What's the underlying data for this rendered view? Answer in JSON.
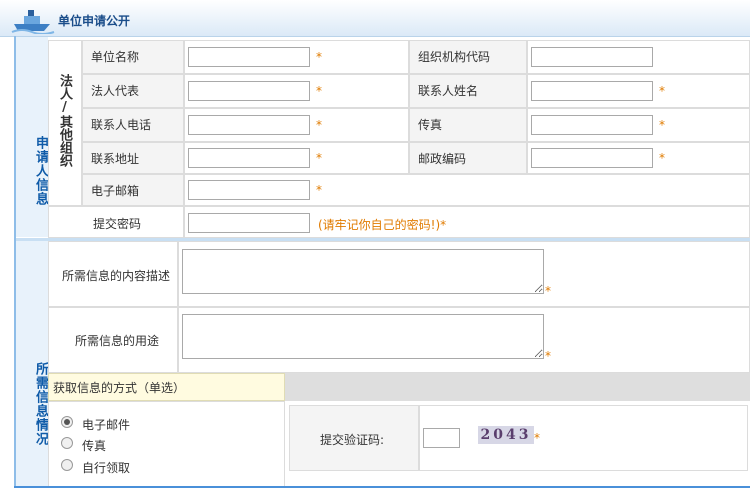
{
  "header": {
    "title": "单位申请公开",
    "logo_icon": "ship-icon"
  },
  "applicant": {
    "section_label": "申请人信息",
    "group_label": "法人/其他组织",
    "fields": {
      "org_name": {
        "label": "单位名称",
        "value": "",
        "required": "*"
      },
      "org_code": {
        "label": "组织机构代码",
        "value": ""
      },
      "legal_rep": {
        "label": "法人代表",
        "value": "",
        "required": "*"
      },
      "contact_name": {
        "label": "联系人姓名",
        "value": "",
        "required": "*"
      },
      "contact_phone": {
        "label": "联系人电话",
        "value": "",
        "required": "*"
      },
      "fax": {
        "label": "传真",
        "value": "",
        "required": "*"
      },
      "address": {
        "label": "联系地址",
        "value": "",
        "required": "*"
      },
      "postcode": {
        "label": "邮政编码",
        "value": "",
        "required": "*"
      },
      "email": {
        "label": "电子邮箱",
        "value": "",
        "required": "*"
      }
    },
    "password": {
      "label": "提交密码",
      "value": "",
      "hint": "(请牢记你自己的密码!)*"
    }
  },
  "info": {
    "section_label": "所需信息情况",
    "description": {
      "label": "所需信息的内容描述",
      "value": "",
      "required": "*"
    },
    "purpose": {
      "label": "所需信息的用途",
      "value": "",
      "required": "*"
    },
    "method": {
      "label": "获取信息的方式（单选）",
      "options": [
        "电子邮件",
        "传真",
        "自行领取"
      ],
      "selected": "电子邮件"
    },
    "captcha": {
      "label": "提交验证码:",
      "value": "",
      "code": "2043",
      "required": "*"
    }
  }
}
